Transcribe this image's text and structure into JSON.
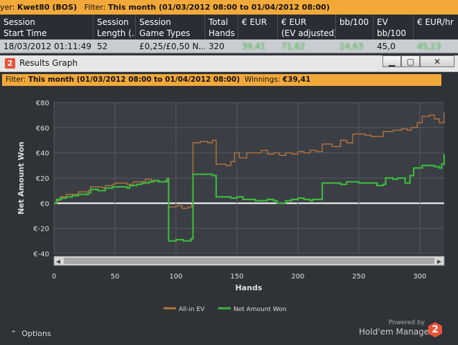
{
  "topbar": {
    "player_label": "yer:",
    "player": "Kwet80 (BOS)",
    "filter_label": "Filter:",
    "filter_value": "This month (01/03/2012 08:00 to 01/04/2012 08:00)"
  },
  "table": {
    "headers": [
      [
        "Session",
        "Start Time"
      ],
      [
        "Session",
        "Length (..."
      ],
      [
        "Session",
        "Game Types"
      ],
      [
        "Total",
        "Hands"
      ],
      [
        "€ EUR",
        ""
      ],
      [
        "€ EUR",
        "(EV adjusted)"
      ],
      [
        "bb/100",
        ""
      ],
      [
        "EV",
        "bb/100"
      ],
      [
        "€ EUR/hr",
        ""
      ]
    ],
    "row": [
      "18/03/2012 01:11:49",
      "52",
      "£0,25/£0,50 N...",
      "320",
      "39,41",
      "71,62",
      "24,63",
      "45,0",
      "45,23"
    ]
  },
  "window": {
    "title": "Results Graph",
    "logo": "2",
    "min_glyph": "▁",
    "max_glyph": "▢",
    "close_glyph": "✕"
  },
  "filter": {
    "label": "Filter:",
    "value": "This month (01/03/2012 08:00 to 01/04/2012 08:00)",
    "winnings_label": "Winnings:",
    "winnings_value": "€39,41"
  },
  "chart_data": {
    "type": "line",
    "xlabel": "Hands",
    "ylabel": "Net Amount Won",
    "xlim": [
      0,
      320
    ],
    "ylim": [
      -40,
      80
    ],
    "x_ticks": [
      "0",
      "50",
      "100",
      "150",
      "200",
      "250",
      "300"
    ],
    "y_ticks": [
      "€80",
      "€60",
      "€40",
      "€20",
      "€0",
      "€-20",
      "€-40"
    ],
    "grid": true,
    "legend_position": "bottom",
    "series": [
      {
        "name": "All-in EV",
        "color": "#b8733a",
        "points": [
          [
            0,
            0
          ],
          [
            2,
            2
          ],
          [
            5,
            5
          ],
          [
            10,
            7
          ],
          [
            20,
            9
          ],
          [
            28,
            10
          ],
          [
            30,
            13
          ],
          [
            40,
            12
          ],
          [
            42,
            14
          ],
          [
            48,
            15
          ],
          [
            50,
            16
          ],
          [
            60,
            15
          ],
          [
            65,
            17
          ],
          [
            70,
            17
          ],
          [
            75,
            19
          ],
          [
            80,
            18
          ],
          [
            85,
            17
          ],
          [
            93,
            20
          ],
          [
            94,
            -3
          ],
          [
            100,
            -2
          ],
          [
            105,
            -4
          ],
          [
            110,
            -3
          ],
          [
            113,
            -1
          ],
          [
            114,
            48
          ],
          [
            120,
            49
          ],
          [
            126,
            48
          ],
          [
            130,
            50
          ],
          [
            133,
            31
          ],
          [
            140,
            31
          ],
          [
            141,
            30
          ],
          [
            145,
            33
          ],
          [
            148,
            40
          ],
          [
            152,
            36
          ],
          [
            158,
            40
          ],
          [
            165,
            40
          ],
          [
            170,
            42
          ],
          [
            175,
            39
          ],
          [
            180,
            40
          ],
          [
            185,
            38
          ],
          [
            190,
            40
          ],
          [
            195,
            39
          ],
          [
            200,
            41
          ],
          [
            205,
            40
          ],
          [
            210,
            42
          ],
          [
            215,
            41
          ],
          [
            220,
            47
          ],
          [
            228,
            45
          ],
          [
            235,
            50
          ],
          [
            240,
            48
          ],
          [
            245,
            55
          ],
          [
            255,
            54
          ],
          [
            260,
            53
          ],
          [
            270,
            57
          ],
          [
            278,
            58
          ],
          [
            285,
            59
          ],
          [
            290,
            58
          ],
          [
            293,
            60
          ],
          [
            298,
            64
          ],
          [
            302,
            69
          ],
          [
            308,
            70
          ],
          [
            312,
            67
          ],
          [
            316,
            64
          ],
          [
            318,
            64
          ],
          [
            320,
            72
          ]
        ]
      },
      {
        "name": "Net Amount Won",
        "color": "#3cb83c",
        "points": [
          [
            0,
            0
          ],
          [
            2,
            3
          ],
          [
            6,
            4
          ],
          [
            10,
            5
          ],
          [
            15,
            6
          ],
          [
            20,
            7
          ],
          [
            28,
            8
          ],
          [
            30,
            11
          ],
          [
            36,
            10
          ],
          [
            40,
            10
          ],
          [
            42,
            12
          ],
          [
            48,
            13
          ],
          [
            54,
            13
          ],
          [
            60,
            12
          ],
          [
            62,
            14
          ],
          [
            68,
            15
          ],
          [
            72,
            16
          ],
          [
            78,
            17
          ],
          [
            82,
            18
          ],
          [
            86,
            17
          ],
          [
            92,
            18
          ],
          [
            93,
            19
          ],
          [
            94,
            -30
          ],
          [
            100,
            -29
          ],
          [
            106,
            -30
          ],
          [
            112,
            -29
          ],
          [
            113,
            -28
          ],
          [
            114,
            23
          ],
          [
            120,
            23
          ],
          [
            126,
            23
          ],
          [
            130,
            22
          ],
          [
            133,
            5
          ],
          [
            140,
            5
          ],
          [
            145,
            4
          ],
          [
            150,
            5
          ],
          [
            155,
            3
          ],
          [
            160,
            3
          ],
          [
            165,
            2
          ],
          [
            170,
            2
          ],
          [
            175,
            3
          ],
          [
            180,
            2
          ],
          [
            183,
            0
          ],
          [
            185,
            0
          ],
          [
            190,
            2
          ],
          [
            195,
            3
          ],
          [
            200,
            4
          ],
          [
            205,
            3
          ],
          [
            210,
            2
          ],
          [
            212,
            3
          ],
          [
            215,
            3
          ],
          [
            220,
            16
          ],
          [
            228,
            16
          ],
          [
            235,
            15
          ],
          [
            240,
            17
          ],
          [
            245,
            17
          ],
          [
            250,
            16
          ],
          [
            260,
            16
          ],
          [
            265,
            14
          ],
          [
            270,
            15
          ],
          [
            272,
            20
          ],
          [
            278,
            19
          ],
          [
            282,
            20
          ],
          [
            285,
            20
          ],
          [
            288,
            16
          ],
          [
            292,
            22
          ],
          [
            295,
            28
          ],
          [
            302,
            30
          ],
          [
            308,
            30
          ],
          [
            312,
            29
          ],
          [
            316,
            28
          ],
          [
            318,
            31
          ],
          [
            320,
            39
          ]
        ]
      }
    ]
  },
  "footer": {
    "options_label": "Options",
    "options_glyph": "⌃",
    "powered_by": "Powered by",
    "brand": "Hold'em Manager",
    "brand_logo": "2"
  }
}
